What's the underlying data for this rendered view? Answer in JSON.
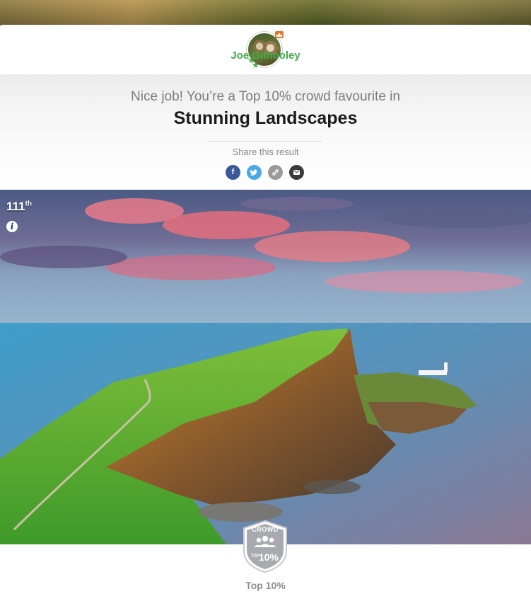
{
  "profile": {
    "user_name": "Joe Gilhooley",
    "avatar": "barn-owls-avatar",
    "crown": "crown-icon",
    "stars": "star-icon"
  },
  "result": {
    "subtitle": "Nice job! You’re a Top 10% crowd favourite in",
    "category": "Stunning Landscapes",
    "share_label": "Share this result",
    "share_buttons": [
      {
        "name": "facebook",
        "glyph": "f",
        "color": "#3b5998"
      },
      {
        "name": "twitter",
        "glyph": "t",
        "color": "#4aa8e8"
      },
      {
        "name": "copy-link",
        "glyph": "link",
        "color": "#9a9a9a"
      },
      {
        "name": "email",
        "glyph": "mail",
        "color": "#3a3a3a"
      }
    ]
  },
  "photo": {
    "subject": "sea cliffs with lighthouse at sunset",
    "rank_number": "111",
    "rank_suffix": "th",
    "info": "i"
  },
  "badge": {
    "top_text": "CROWD",
    "small_text": "TOP",
    "percent_text": "10%",
    "caption": "Top 10%"
  },
  "colors": {
    "accent_green": "#3fae49",
    "badge_gray": "#a9aab0"
  }
}
